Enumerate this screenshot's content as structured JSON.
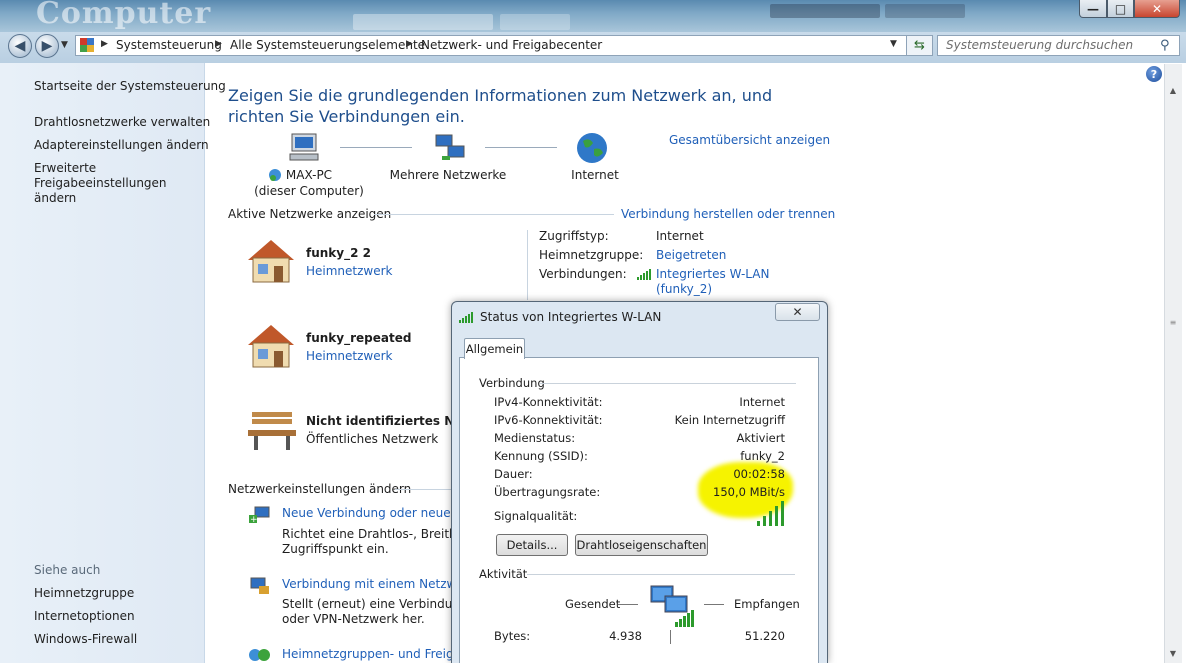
{
  "window": {
    "title_logo": "Computer",
    "buttons": {
      "minimize": "—",
      "maximize": "□",
      "close": "✕"
    }
  },
  "address": {
    "crumbs": [
      "Systemsteuerung",
      "Alle Systemsteuerungselemente",
      "Netzwerk- und Freigabecenter"
    ],
    "search_placeholder": "Systemsteuerung durchsuchen"
  },
  "sidebar": {
    "home": "Startseite der Systemsteuerung",
    "items": [
      "Drahtlosnetzwerke verwalten",
      "Adaptereinstellungen ändern",
      "Erweiterte Freigabeeinstellungen ändern"
    ],
    "see_also_heading": "Siehe auch",
    "see_also": [
      "Heimnetzgruppe",
      "Internetoptionen",
      "Windows-Firewall"
    ]
  },
  "main": {
    "heading": "Zeigen Sie die grundlegenden Informationen zum Netzwerk an, und richten Sie Verbindungen ein.",
    "overview_link": "Gesamtübersicht anzeigen",
    "map": {
      "computer_name": "MAX-PC",
      "computer_sub": "(dieser Computer)",
      "networks": "Mehrere Netzwerke",
      "internet": "Internet"
    },
    "active_heading": "Aktive Netzwerke anzeigen",
    "connect_link": "Verbindung herstellen oder trennen",
    "networks": [
      {
        "name": "funky_2  2",
        "type": "Heimnetzwerk"
      },
      {
        "name": "funky_repeated",
        "type": "Heimnetzwerk"
      },
      {
        "name": "Nicht identifiziertes Netzwerk",
        "type": "Öffentliches Netzwerk"
      }
    ],
    "details": {
      "access_label": "Zugriffstyp:",
      "access_value": "Internet",
      "homegroup_label": "Heimnetzgruppe:",
      "homegroup_value": "Beigetreten",
      "connections_label": "Verbindungen:",
      "connections_value_1": "Integriertes W-LAN",
      "connections_value_2": "(funky_2)"
    },
    "settings_heading": "Netzwerkeinstellungen ändern",
    "tasks": [
      {
        "title": "Neue Verbindung oder neues Netzwerk einrichten",
        "desc_1": "Richtet eine Drahtlos-, Breitband-, Einwähl-, Ad-hoc- oder VPN-Verbindung bzw. einen Router oder",
        "desc_2": "Zugriffspunkt ein."
      },
      {
        "title": "Verbindung mit einem Netzwerk herstellen",
        "desc_1": "Stellt (erneut) eine Verbindung mit einer drahtlosen, verkabelten, Einwähl-",
        "desc_2": "oder VPN-Netzwerk her."
      },
      {
        "title": "Heimnetzgruppen- und Freigabeoptionen auswählen"
      }
    ]
  },
  "dialog": {
    "title": "Status von Integriertes W-LAN",
    "close": "✕",
    "tab": "Allgemein",
    "group_connection": "Verbindung",
    "rows": [
      {
        "label": "IPv4-Konnektivität:",
        "value": "Internet"
      },
      {
        "label": "IPv6-Konnektivität:",
        "value": "Kein Internetzugriff"
      },
      {
        "label": "Medienstatus:",
        "value": "Aktiviert"
      },
      {
        "label": "Kennung (SSID):",
        "value": "funky_2"
      },
      {
        "label": "Dauer:",
        "value": "00:02:58"
      },
      {
        "label": "Übertragungsrate:",
        "value": "150,0 MBit/s"
      }
    ],
    "signal_label": "Signalqualität:",
    "signal_bars": 5,
    "signal_max": 5,
    "btn_details": "Details...",
    "btn_wireless": "Drahtloseigenschaften",
    "group_activity": "Aktivität",
    "sent_label": "Gesendet",
    "received_label": "Empfangen",
    "bytes_label": "Bytes:",
    "bytes_sent": "4.938",
    "bytes_received": "51.220"
  },
  "colors": {
    "link": "#1f5fb8",
    "heading": "#1e4e8c",
    "highlight": "#f6f300",
    "signal": "#2c9a2c"
  }
}
